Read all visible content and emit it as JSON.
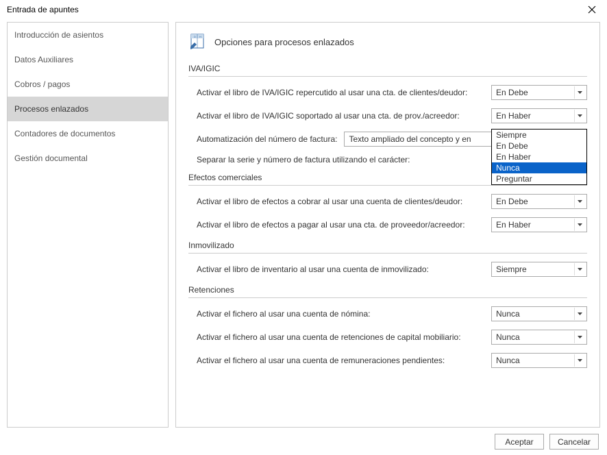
{
  "window": {
    "title": "Entrada de apuntes"
  },
  "sidebar": {
    "items": [
      {
        "label": "Introducción de asientos"
      },
      {
        "label": "Datos Auxiliares"
      },
      {
        "label": "Cobros / pagos"
      },
      {
        "label": "Procesos enlazados"
      },
      {
        "label": "Contadores de documentos"
      },
      {
        "label": "Gestión documental"
      }
    ],
    "selected_index": 3
  },
  "page": {
    "title": "Opciones para procesos enlazados"
  },
  "sections": {
    "iva": {
      "header": "IVA/IGIC",
      "row_repercutido": {
        "label": "Activar el libro de IVA/IGIC repercutido al usar una cta. de clientes/deudor:",
        "value": "En Debe"
      },
      "row_soportado": {
        "label": "Activar el libro de IVA/IGIC soportado al usar una cta. de prov./acreedor:",
        "value": "En Haber"
      },
      "row_autofactura": {
        "label": "Automatización del número de factura:",
        "input_value": "Texto ampliado del concepto y en"
      },
      "row_separar": {
        "label": "Separar la serie y número de factura utilizando el carácter:"
      }
    },
    "efectos": {
      "header": "Efectos comerciales",
      "row_cobrar": {
        "label": "Activar el libro de efectos a cobrar al usar una cuenta de clientes/deudor:",
        "value": "En Debe"
      },
      "row_pagar": {
        "label": "Activar el libro de efectos a pagar al usar una cta. de proveedor/acreedor:",
        "value": "En Haber"
      }
    },
    "inmovilizado": {
      "header": "Inmovilizado",
      "row_inventario": {
        "label": "Activar el libro de inventario al usar una cuenta de inmovilizado:",
        "value": "Siempre"
      }
    },
    "retenciones": {
      "header": "Retenciones",
      "row_nomina": {
        "label": "Activar el fichero al usar una cuenta de nómina:",
        "value": "Nunca"
      },
      "row_capital": {
        "label": "Activar el fichero al usar una cuenta de retenciones de capital mobiliario:",
        "value": "Nunca"
      },
      "row_remuneraciones": {
        "label": "Activar el fichero al usar una cuenta de remuneraciones pendientes:",
        "value": "Nunca"
      }
    }
  },
  "dropdown": {
    "options": [
      "Siempre",
      "En Debe",
      "En Haber",
      "Nunca",
      "Preguntar"
    ],
    "highlighted_index": 3
  },
  "buttons": {
    "accept": "Aceptar",
    "cancel": "Cancelar"
  }
}
